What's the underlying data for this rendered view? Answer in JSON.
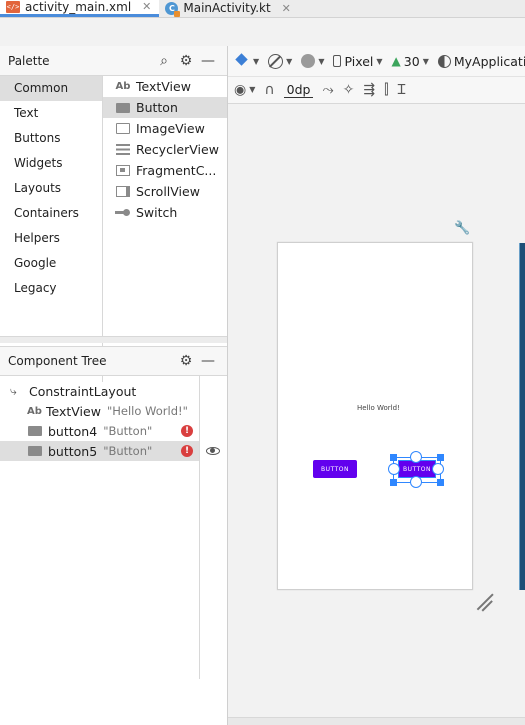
{
  "tabs": [
    {
      "label": "activity_main.xml",
      "icon": "xml-file-icon",
      "active": true
    },
    {
      "label": "MainActivity.kt",
      "icon": "kotlin-file-icon",
      "active": false
    }
  ],
  "palette": {
    "title": "Palette",
    "categories": [
      "Common",
      "Text",
      "Buttons",
      "Widgets",
      "Layouts",
      "Containers",
      "Helpers",
      "Google",
      "Legacy"
    ],
    "selected_category": "Common",
    "items": [
      "TextView",
      "Button",
      "ImageView",
      "RecyclerView",
      "FragmentC...",
      "ScrollView",
      "Switch"
    ],
    "selected_item": "Button",
    "textview_prefix": "Ab"
  },
  "component_tree": {
    "title": "Component Tree",
    "rows": [
      {
        "label": "ConstraintLayout",
        "hint": "",
        "icon": "constraint-layout-icon"
      },
      {
        "label": "TextView",
        "hint": "\"Hello World!\"",
        "icon": "textview-icon"
      },
      {
        "label": "button4",
        "hint": "\"Button\"",
        "icon": "button-icon",
        "error": true
      },
      {
        "label": "button5",
        "hint": "\"Button\"",
        "icon": "button-icon",
        "error": true,
        "selected": true
      }
    ]
  },
  "toolbar": {
    "device": "Pixel",
    "api": "30",
    "theme": "MyApplication",
    "margin": "0dp"
  },
  "canvas": {
    "hello_text": "Hello World!",
    "button4_label": "BUTTON",
    "button5_label": "BUTTON"
  },
  "colors": {
    "button": "#6200ee",
    "selection": "#2f87ff",
    "error": "#d93f3f",
    "tab_underline": "#4a8cdb"
  }
}
